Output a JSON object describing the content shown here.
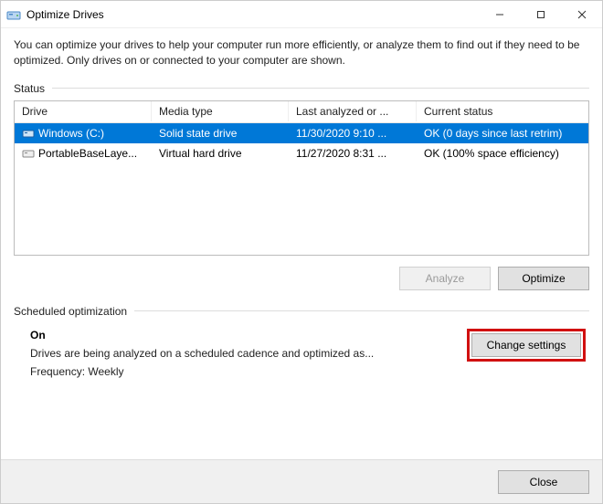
{
  "window": {
    "title": "Optimize Drives"
  },
  "intro": "You can optimize your drives to help your computer run more efficiently, or analyze them to find out if they need to be optimized. Only drives on or connected to your computer are shown.",
  "status": {
    "label": "Status",
    "columns": {
      "drive": "Drive",
      "media": "Media type",
      "last": "Last analyzed or ...",
      "status": "Current status"
    },
    "rows": [
      {
        "drive": "Windows (C:)",
        "media": "Solid state drive",
        "last": "11/30/2020 9:10 ...",
        "status": "OK (0 days since last retrim)",
        "selected": true
      },
      {
        "drive": "PortableBaseLaye...",
        "media": "Virtual hard drive",
        "last": "11/27/2020 8:31 ...",
        "status": "OK (100% space efficiency)",
        "selected": false
      }
    ],
    "buttons": {
      "analyze": "Analyze",
      "optimize": "Optimize"
    }
  },
  "scheduled": {
    "label": "Scheduled optimization",
    "heading": "On",
    "description": "Drives are being analyzed on a scheduled cadence and optimized as...",
    "frequency_label": "Frequency:",
    "frequency_value": "Weekly",
    "change_button": "Change settings"
  },
  "footer": {
    "close": "Close"
  }
}
